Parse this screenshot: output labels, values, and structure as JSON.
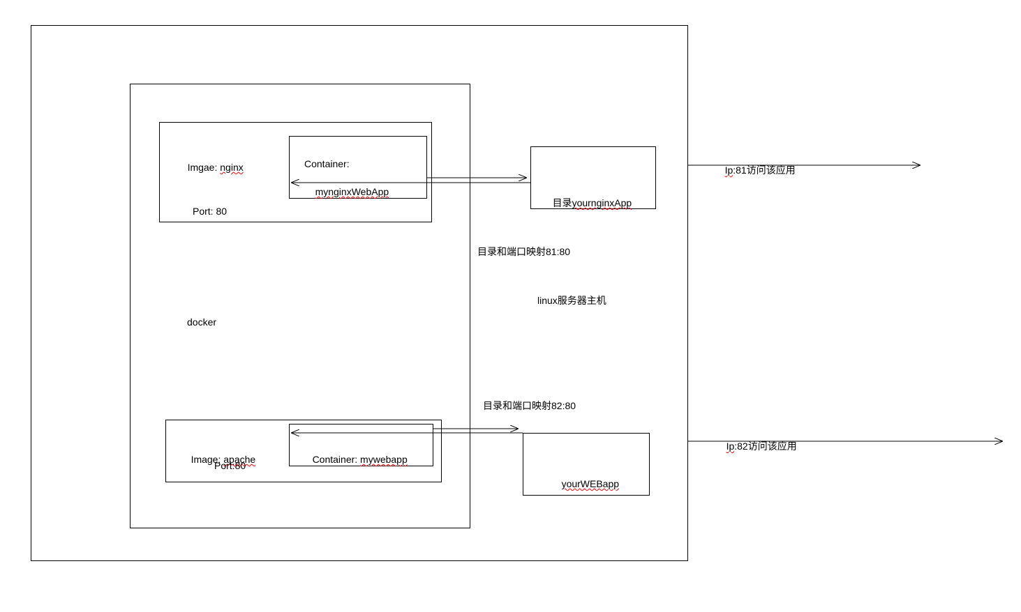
{
  "host": {
    "label": "linux服务器主机"
  },
  "docker": {
    "label": "docker"
  },
  "nginx": {
    "image_prefix": "Imgae: ",
    "image_name": "nginx",
    "port_label": "Port: 80",
    "container_label": "Container:",
    "container_name": "mynginxWebApp"
  },
  "apache": {
    "image_prefix": "Image: ",
    "image_name": "apache",
    "port_label": "Port:80",
    "container_label": "Container: ",
    "container_name": "mywebapp"
  },
  "dir1": {
    "prefix": "目录",
    "name": "yournginxApp"
  },
  "dir2": {
    "name": "yourWEBapp"
  },
  "map1": "目录和端口映射81:80",
  "map2": "目录和端口映射82:80",
  "ext1": {
    "prefix": "Ip",
    "rest": ":81访问该应用"
  },
  "ext2": {
    "prefix": "Ip",
    "rest": ":82访问该应用"
  }
}
